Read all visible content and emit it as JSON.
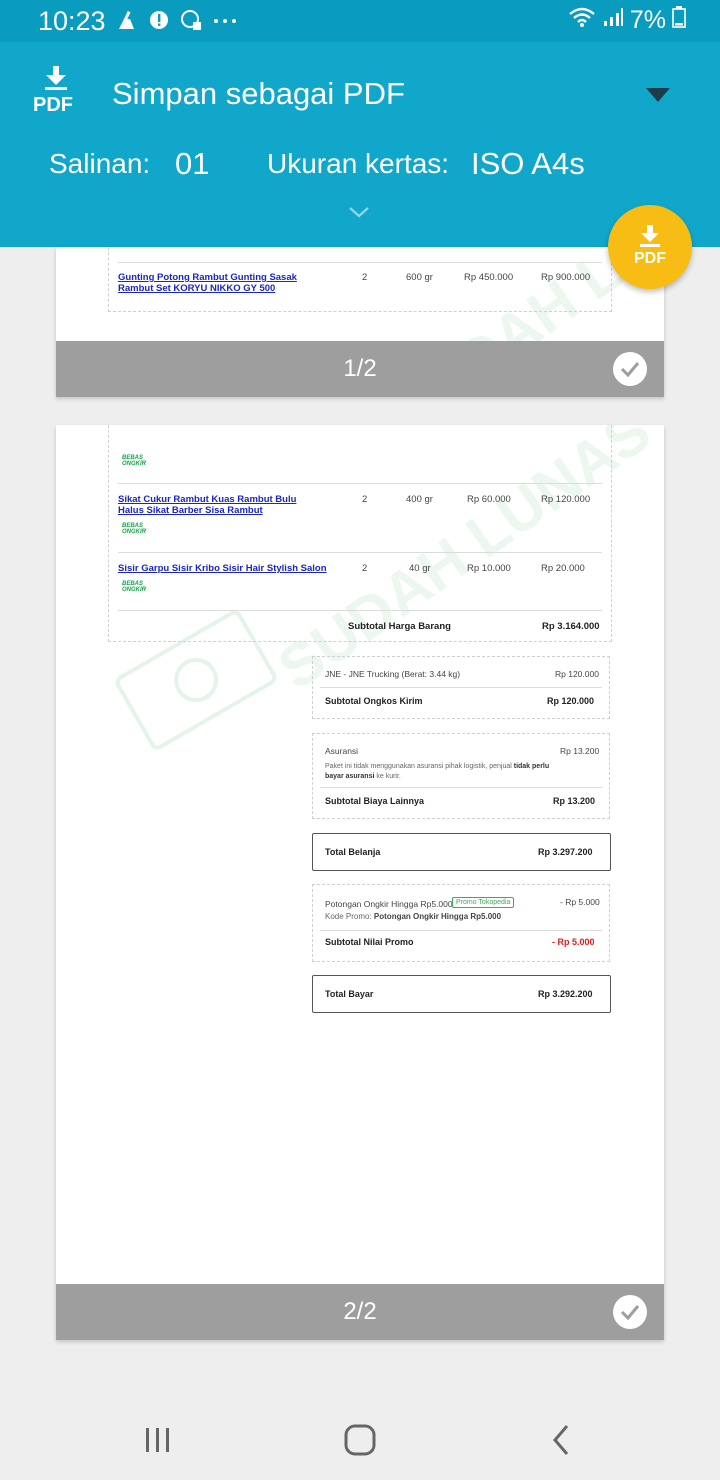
{
  "status": {
    "time": "10:23",
    "battery": "7%",
    "icons": [
      "cleaner-icon",
      "alert-icon",
      "whatsapp-icon",
      "more-dots-icon",
      "wifi-icon",
      "signal-icon",
      "battery-icon"
    ]
  },
  "header": {
    "pdf_label": "PDF",
    "printer": "Simpan sebagai PDF",
    "copies_label": "Salinan:",
    "copies_value": "01",
    "paper_label": "Ukuran kertas:",
    "paper_value": "ISO A4s",
    "accent_color": "#10a7cb",
    "fab_color": "#f7bd15"
  },
  "fab": {
    "label": "PDF"
  },
  "watermark_text": "SUDAH LUNAS",
  "page1": {
    "indicator": "1/2",
    "row": {
      "name": "Gunting Potong Rambut Gunting Sasak Rambut Set KORYU NIKKO GY 500",
      "qty": "2",
      "weight": "600 gr",
      "price": "Rp 450.000",
      "total": "Rp 900.000"
    }
  },
  "page2": {
    "indicator": "2/2",
    "badge": "BEBAS ONGKIR",
    "rows": [
      {
        "name": "Sikat Cukur Rambut Kuas Rambut Bulu Halus Sikat Barber Sisa Rambut",
        "qty": "2",
        "weight": "400 gr",
        "price": "Rp 60.000",
        "total": "Rp 120.000"
      },
      {
        "name": "Sisir Garpu Sisir Kribo Sisir Hair Stylish Salon",
        "qty": "2",
        "weight": "40 gr",
        "price": "Rp 10.000",
        "total": "Rp 20.000"
      }
    ],
    "subtotal_barang_label": "Subtotal Harga Barang",
    "subtotal_barang_value": "Rp 3.164.000",
    "shipping": {
      "line_label": "JNE - JNE Trucking (Berat: 3.44 kg)",
      "line_value": "Rp 120.000",
      "subtotal_label": "Subtotal Ongkos Kirim",
      "subtotal_value": "Rp 120.000"
    },
    "other": {
      "line_label": "Asuransi",
      "line_value": "Rp 13.200",
      "note_pre": "Paket ini tidak menggunakan asuransi pihak logistik, penjual ",
      "note_bold1": "tidak",
      "note_bold2": "perlu bayar asuransi",
      "note_post": " ke kurir.",
      "subtotal_label": "Subtotal Biaya Lainnya",
      "subtotal_value": "Rp 13.200"
    },
    "total_belanja_label": "Total Belanja",
    "total_belanja_value": "Rp 3.297.200",
    "promo": {
      "line_label": "Potongan Ongkir Hingga Rp5.000",
      "tag": "Promo Tokopedia",
      "line_value": "- Rp 5.000",
      "code_label": "Kode Promo: ",
      "code_value": "Potongan Ongkir Hingga Rp5.000",
      "subtotal_label": "Subtotal Nilai Promo",
      "subtotal_value": "- Rp 5.000"
    },
    "total_bayar_label": "Total Bayar",
    "total_bayar_value": "Rp 3.292.200"
  }
}
